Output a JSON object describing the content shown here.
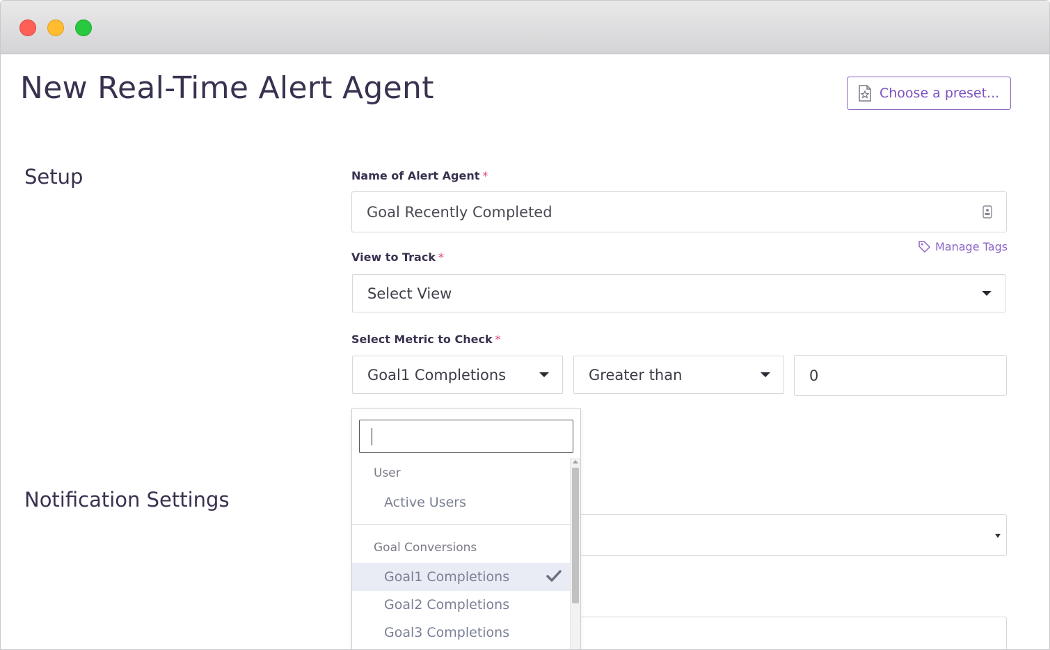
{
  "window": {
    "title": ""
  },
  "page": {
    "title": "New Real-Time Alert Agent",
    "preset_button": "Choose a preset..."
  },
  "setup": {
    "section_title": "Setup",
    "name_label": "Name of Alert Agent",
    "name_value": "Goal Recently Completed",
    "manage_tags": "Manage Tags",
    "view_label": "View to Track",
    "view_value": "Select View",
    "metric_label": "Select Metric to Check",
    "metric_value": "Goal1 Completions",
    "condition_value": "Greater than",
    "threshold_value": "0",
    "required_mark": "*"
  },
  "notifications": {
    "section_title": "Notification Settings"
  },
  "metric_dropdown": {
    "search_value": "",
    "groups": [
      {
        "label": "User",
        "items": [
          {
            "label": "Active Users",
            "selected": false
          }
        ]
      },
      {
        "label": "Goal Conversions",
        "items": [
          {
            "label": "Goal1 Completions",
            "selected": true
          },
          {
            "label": "Goal2 Completions",
            "selected": false
          },
          {
            "label": "Goal3 Completions",
            "selected": false
          }
        ]
      }
    ]
  },
  "colors": {
    "accent": "#8a64c6",
    "required": "#e0457b",
    "text": "#3a3150",
    "selected_bg": "#e9ecf5"
  },
  "icons": {
    "preset": "document-star-icon",
    "tag": "tag-icon",
    "contact": "contact-card-icon",
    "check": "checkmark-icon"
  }
}
